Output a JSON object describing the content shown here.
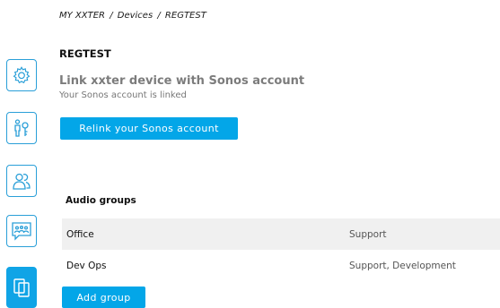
{
  "breadcrumb": {
    "items": [
      "MY XXTER",
      "Devices",
      "REGTEST"
    ],
    "separator": "/"
  },
  "page": {
    "title": "REGTEST"
  },
  "sonos": {
    "heading": "Link xxter device with Sonos account",
    "status": "Your Sonos account is linked",
    "relink_label": "Relink your Sonos account"
  },
  "audio_groups": {
    "title": "Audio groups",
    "rows": [
      {
        "name": "Office",
        "roles": "Support"
      },
      {
        "name": "Dev Ops",
        "roles": "Support, Development"
      }
    ],
    "add_label": "Add group"
  },
  "sidebar": {
    "icons": [
      "settings-icon",
      "users-keys-icon",
      "people-icon",
      "group-card-icon",
      "devices-icon"
    ],
    "active": "devices-icon"
  },
  "colors": {
    "accent": "#03a6e8",
    "icon_stroke": "#2a9fd8",
    "row_shade": "#f0f0f0"
  }
}
